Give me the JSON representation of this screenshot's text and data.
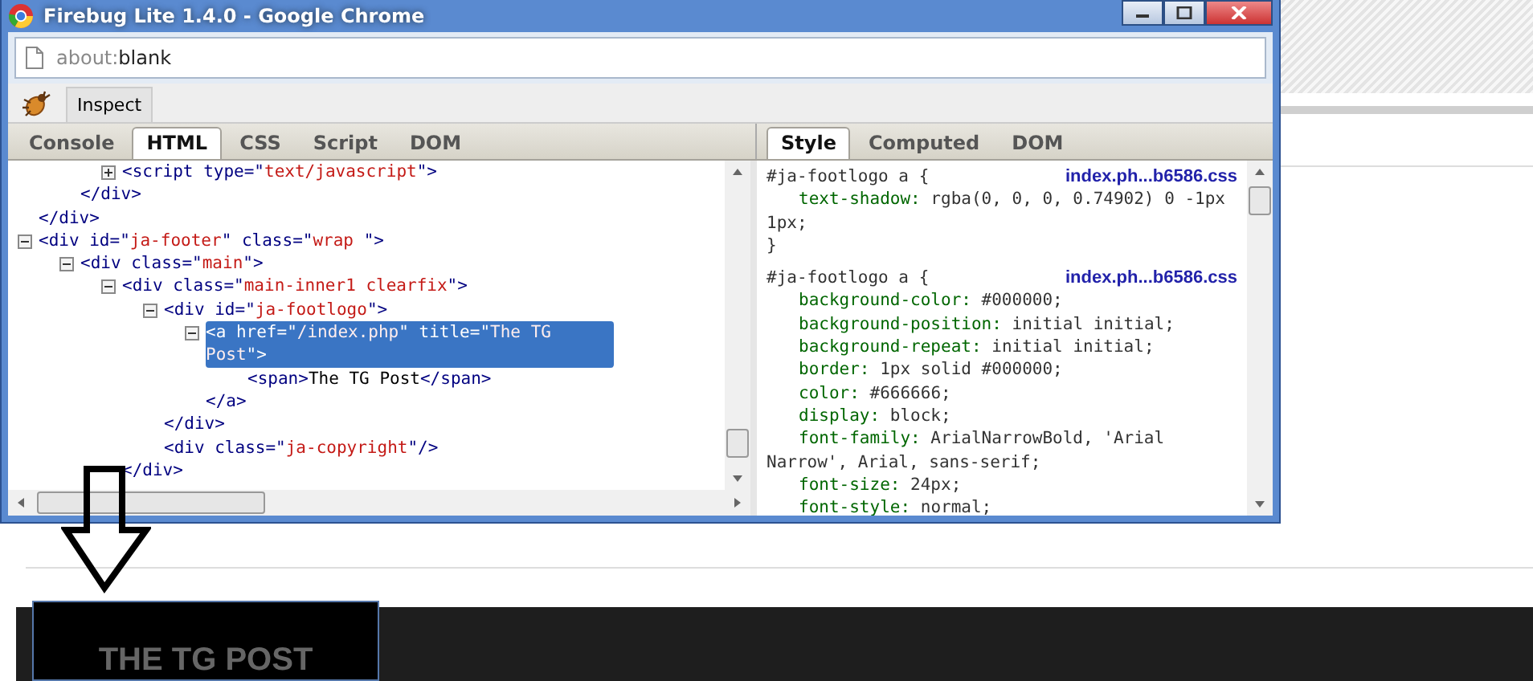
{
  "window": {
    "title": "Firebug Lite 1.4.0 - Google Chrome"
  },
  "address_bar": {
    "scheme": "about:",
    "path": "blank"
  },
  "toolbar": {
    "button": "Inspect"
  },
  "panel_tabs": [
    {
      "label": "Console",
      "selected": false
    },
    {
      "label": "HTML",
      "selected": true
    },
    {
      "label": "CSS",
      "selected": false
    },
    {
      "label": "Script",
      "selected": false
    },
    {
      "label": "DOM",
      "selected": false
    }
  ],
  "html_tree": [
    {
      "children": [
        {
          "children": [
            {
              "open": [
                {
                  "kind": "markup",
                  "text": "<script type=\""
                },
                {
                  "kind": "value",
                  "text": "text/javascript"
                },
                {
                  "kind": "markup",
                  "text": "\">"
                }
              ],
              "expanded": false,
              "selected": false
            }
          ],
          "close": "</div>"
        }
      ],
      "close": "</div>"
    },
    {
      "open": [
        {
          "kind": "markup",
          "text": "<div id=\""
        },
        {
          "kind": "value",
          "text": "ja-footer"
        },
        {
          "kind": "markup",
          "text": "\" class=\""
        },
        {
          "kind": "value",
          "text": "wrap "
        },
        {
          "kind": "markup",
          "text": "\">"
        }
      ],
      "expanded": true,
      "selected": false,
      "children": [
        {
          "open": [
            {
              "kind": "markup",
              "text": "<div class=\""
            },
            {
              "kind": "value",
              "text": "main"
            },
            {
              "kind": "markup",
              "text": "\">"
            }
          ],
          "expanded": true,
          "selected": false,
          "children": [
            {
              "open": [
                {
                  "kind": "markup",
                  "text": "<div class=\""
                },
                {
                  "kind": "value",
                  "text": "main-inner1 clearfix"
                },
                {
                  "kind": "markup",
                  "text": "\">"
                }
              ],
              "expanded": true,
              "selected": false,
              "children": [
                {
                  "open": [
                    {
                      "kind": "markup",
                      "text": "<div id=\""
                    },
                    {
                      "kind": "value",
                      "text": "ja-footlogo"
                    },
                    {
                      "kind": "markup",
                      "text": "\">"
                    }
                  ],
                  "expanded": true,
                  "selected": false,
                  "children": [
                    {
                      "open": [
                        {
                          "kind": "markup",
                          "text": "<a href=\""
                        },
                        {
                          "kind": "value",
                          "text": "/index.php"
                        },
                        {
                          "kind": "markup",
                          "text": "\" title=\""
                        },
                        {
                          "kind": "value",
                          "text": "The TG Post"
                        },
                        {
                          "kind": "markup",
                          "text": "\">"
                        }
                      ],
                      "expanded": true,
                      "selected": true,
                      "children": [
                        {
                          "open": [
                            {
                              "kind": "markup",
                              "text": "<span>"
                            },
                            {
                              "kind": "text",
                              "text": "The TG Post"
                            },
                            {
                              "kind": "markup",
                              "text": "</span>"
                            }
                          ],
                          "selected": false
                        }
                      ],
                      "close": "</a>"
                    }
                  ],
                  "close": "</div>"
                },
                {
                  "open": [
                    {
                      "kind": "markup",
                      "text": "<div class=\""
                    },
                    {
                      "kind": "value",
                      "text": "ja-copyright"
                    },
                    {
                      "kind": "markup",
                      "text": "\"/>"
                    }
                  ],
                  "selected": false
                }
              ],
              "close": "</div>"
            }
          ]
        }
      ]
    }
  ],
  "side_tabs": [
    {
      "label": "Style",
      "selected": true
    },
    {
      "label": "Computed",
      "selected": false
    },
    {
      "label": "DOM",
      "selected": false
    }
  ],
  "style_rules": [
    {
      "selector": "#ja-footlogo a {",
      "source": "index.ph...b6586.css",
      "properties": [
        {
          "name": "text-shadow:",
          "value": "rgba(0, 0, 0, 0.74902) 0 -1px 1px;"
        }
      ],
      "close": "}"
    },
    {
      "selector": "#ja-footlogo a {",
      "source": "index.ph...b6586.css",
      "properties": [
        {
          "name": "background-color:",
          "value": "#000000;"
        },
        {
          "name": "background-position:",
          "value": "initial initial;"
        },
        {
          "name": "background-repeat:",
          "value": "initial initial;"
        },
        {
          "name": "border:",
          "value": "1px solid #000000;"
        },
        {
          "name": "color:",
          "value": "#666666;"
        },
        {
          "name": "display:",
          "value": "block;"
        },
        {
          "name": "font-family:",
          "value": "ArialNarrowBold, 'Arial Narrow', Arial, sans-serif;"
        },
        {
          "name": "font-size:",
          "value": "24px;"
        },
        {
          "name": "font-style:",
          "value": "normal;"
        }
      ]
    }
  ],
  "page": {
    "logo": "THE TG POST"
  }
}
